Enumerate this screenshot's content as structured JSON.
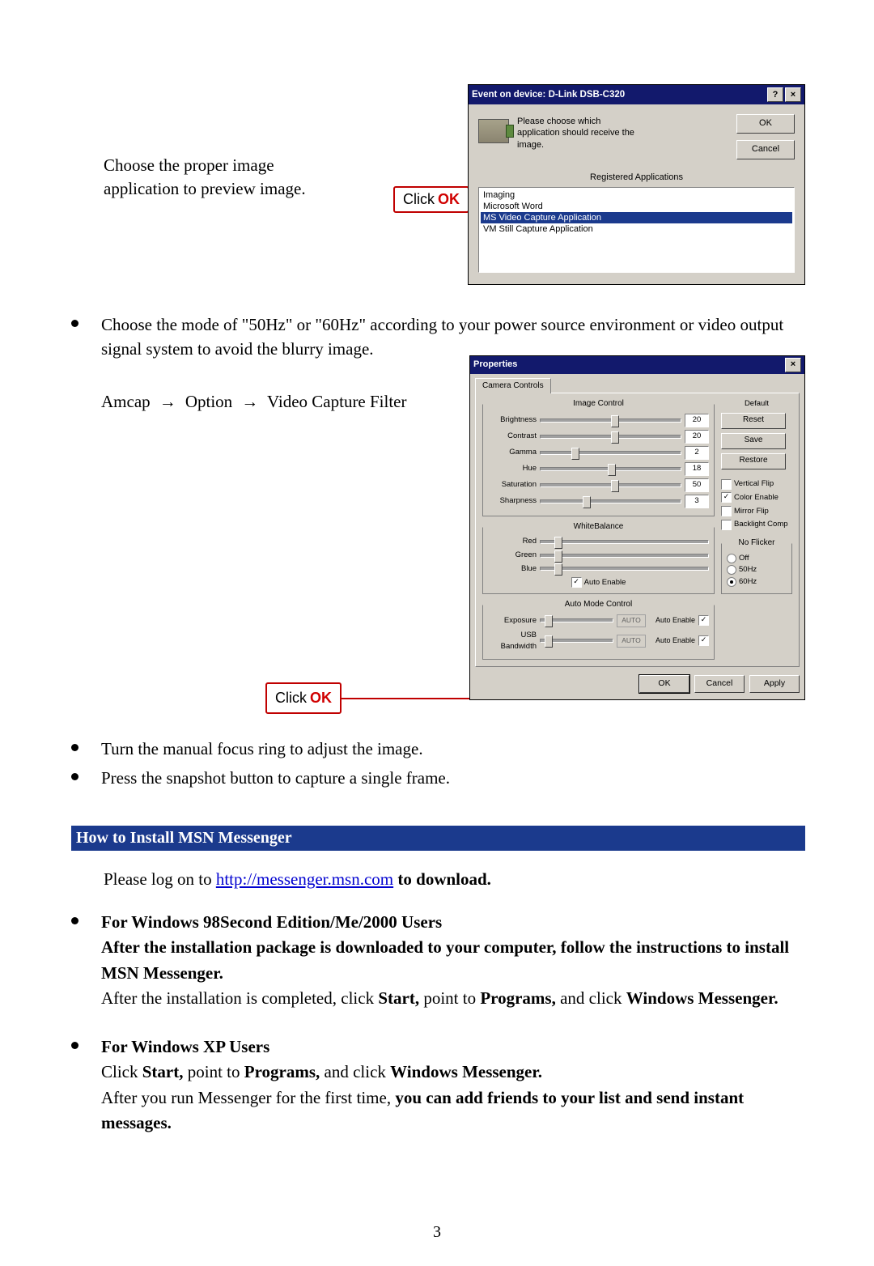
{
  "callouts": {
    "click_ok_prefix": "Click",
    "click_ok_ok": "OK"
  },
  "upper_left": {
    "line1": "Choose the proper image",
    "line2": "application to preview image."
  },
  "event_dialog": {
    "title": "Event on  device: D-Link DSB-C320",
    "help_btn": "?",
    "close_btn": "×",
    "instruction_l1": "Please choose which",
    "instruction_l2": "application should receive the",
    "instruction_l3": "image.",
    "ok": "OK",
    "cancel": "Cancel",
    "reg_apps_label": "Registered Applications",
    "apps": [
      {
        "label": "Imaging",
        "selected": false
      },
      {
        "label": "Microsoft Word",
        "selected": false
      },
      {
        "label": "MS Video Capture Application",
        "selected": true
      },
      {
        "label": "VM Still Capture Application",
        "selected": false
      }
    ]
  },
  "bullet_hz": "Choose the mode of \"50Hz\" or \"60Hz\" according to your power source environment or video output signal system to avoid the blurry image.",
  "amcap_path": {
    "a": "Amcap",
    "b": "Option",
    "c": "Video Capture Filter"
  },
  "props": {
    "title": "Properties",
    "close": "×",
    "tab": "Camera Controls",
    "grp_image": "Image Control",
    "brightness": {
      "label": "Brightness",
      "value": "20",
      "pos": 50
    },
    "contrast": {
      "label": "Contrast",
      "value": "20",
      "pos": 50
    },
    "gamma": {
      "label": "Gamma",
      "value": "2",
      "pos": 22
    },
    "hue": {
      "label": "Hue",
      "value": "18",
      "pos": 48
    },
    "saturation": {
      "label": "Saturation",
      "value": "50",
      "pos": 50
    },
    "sharpness": {
      "label": "Sharpness",
      "value": "3",
      "pos": 30
    },
    "default_label": "Default",
    "reset": "Reset",
    "save": "Save",
    "restore": "Restore",
    "vflip": "Vertical Flip",
    "color_enable": "Color Enable",
    "mflip": "Mirror Flip",
    "backlight": "Backlight Comp",
    "grp_wb": "WhiteBalance",
    "wb_red": {
      "label": "Red",
      "pos": 8
    },
    "wb_green": {
      "label": "Green",
      "pos": 8
    },
    "wb_blue": {
      "label": "Blue",
      "pos": 8
    },
    "wb_auto_enable": "Auto Enable",
    "grp_noflicker": "No Flicker",
    "nf_off": "Off",
    "nf_50": "50Hz",
    "nf_60": "60Hz",
    "grp_auto": "Auto Mode Control",
    "exposure": {
      "label": "Exposure",
      "val": "AUTO",
      "pos": 6
    },
    "usbbw": {
      "label": "USB Bandwidth",
      "val": "AUTO",
      "pos": 6
    },
    "auto_enable": "Auto Enable",
    "btn_ok": "OK",
    "btn_cancel": "Cancel",
    "btn_apply": "Apply"
  },
  "bullets_after": {
    "b1": "Turn the manual focus ring to adjust the image.",
    "b2": "Press the snapshot button to capture a single frame."
  },
  "section_header": "How to Install MSN Messenger",
  "msn_intro_prefix": "Please log on to ",
  "msn_link_text": "http://messenger.msn.com",
  "msn_intro_suffix": " to download.",
  "win98": {
    "title": "For Windows 98Second Edition/Me/2000 Users",
    "l1": "After the installation package is downloaded to your computer, follow the instructions to install MSN Messenger.",
    "l2_a": "After the installation is completed, click ",
    "l2_b": "Start,",
    "l2_c": " point to ",
    "l2_d": "Programs,",
    "l2_e": " and click ",
    "l2_f": "Windows Messenger."
  },
  "winxp": {
    "title": "For Windows XP Users",
    "l1_a": "Click ",
    "l1_b": "Start,",
    "l1_c": " point to ",
    "l1_d": "Programs,",
    "l1_e": " and click ",
    "l1_f": "Windows Messenger.",
    "l2_a": "After you run Messenger for the first time, ",
    "l2_b": "you can add friends to your list and send instant messages."
  },
  "page_number": "3"
}
